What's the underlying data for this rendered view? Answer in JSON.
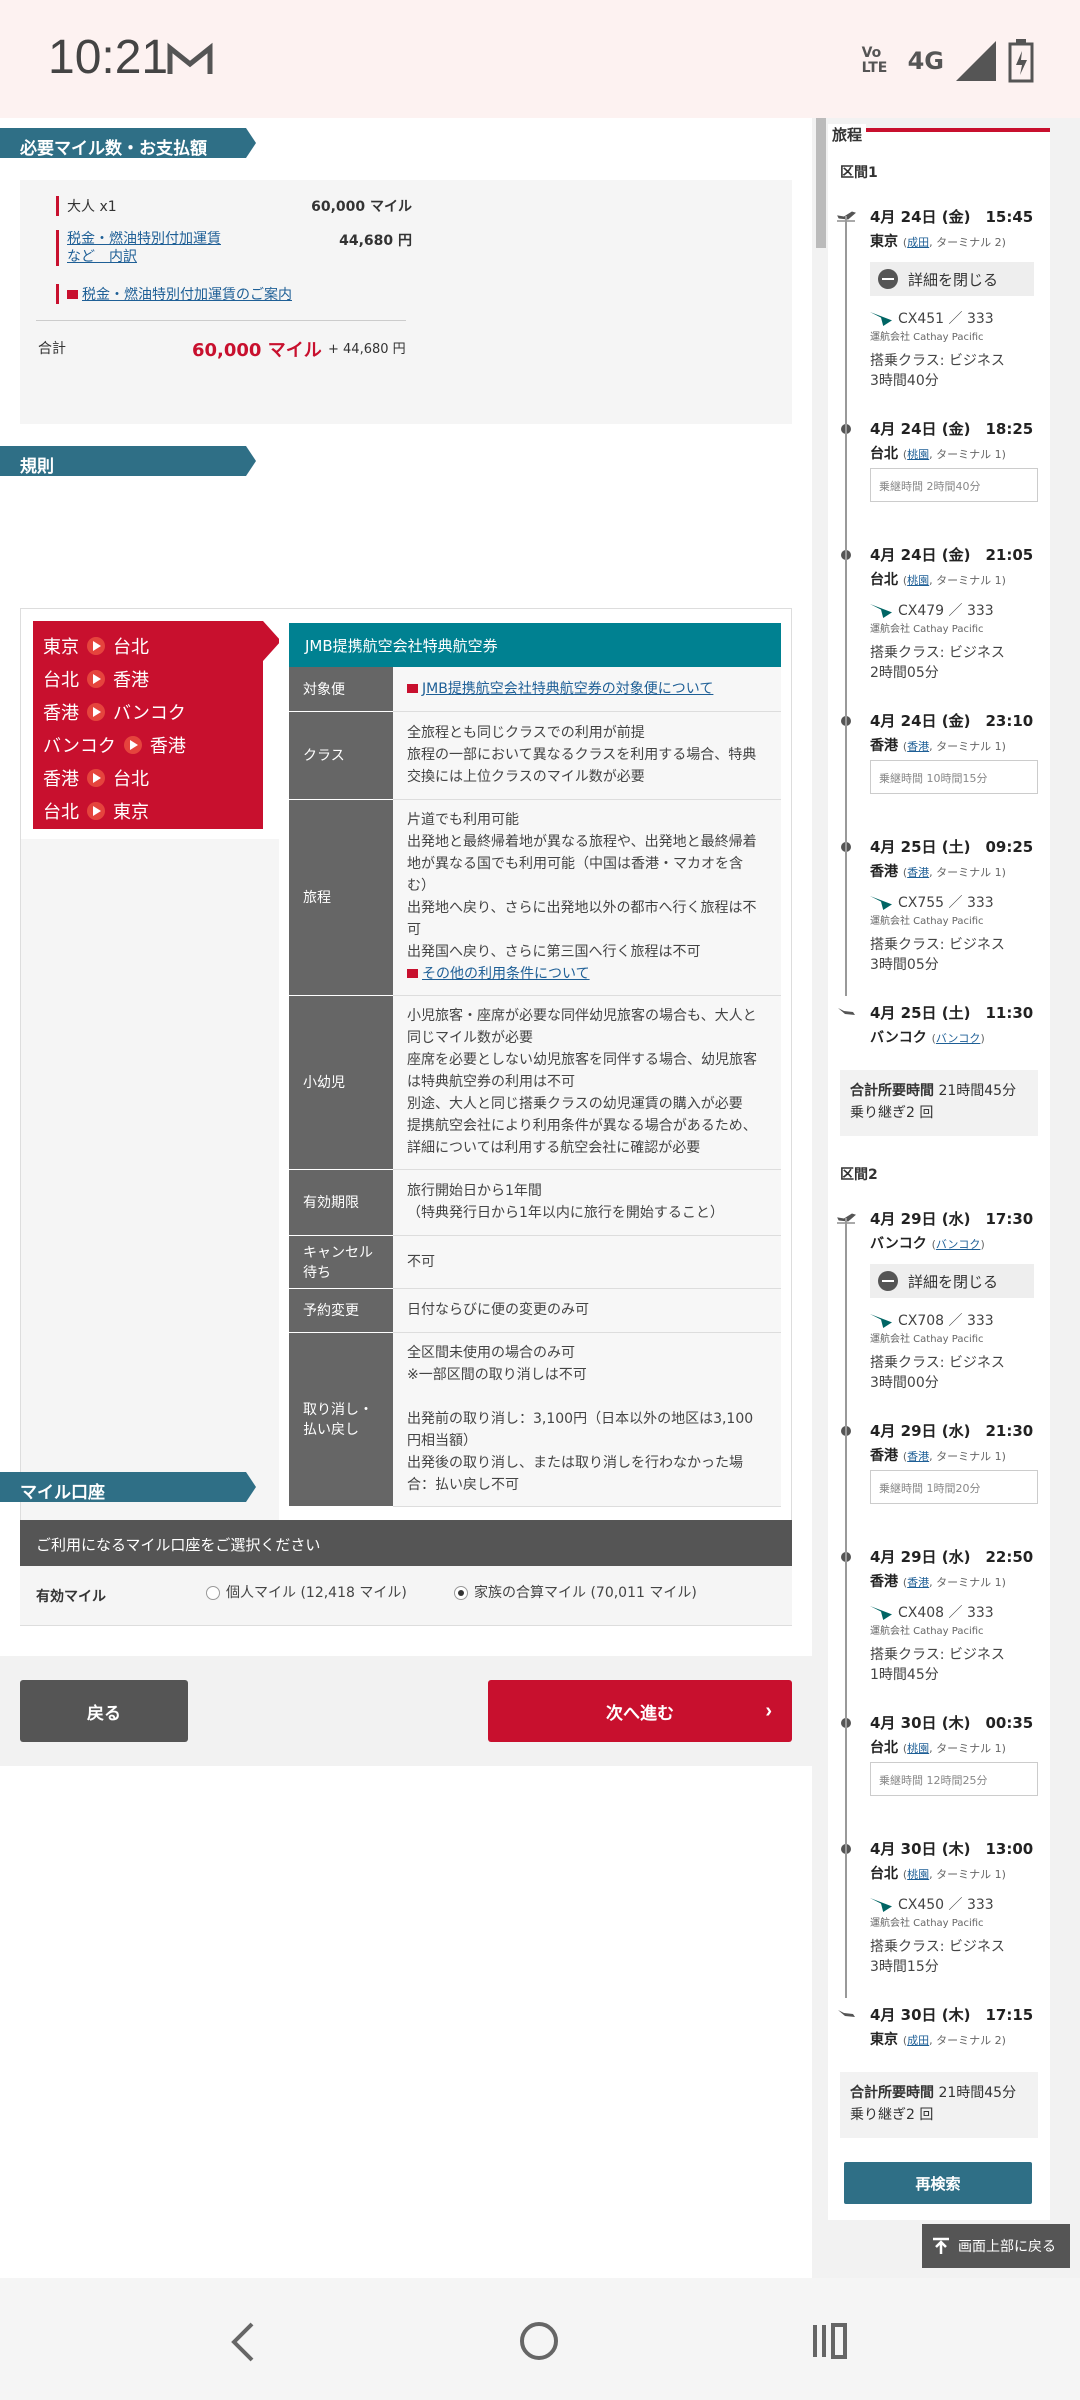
{
  "status": {
    "time": "10:21",
    "net": "4G",
    "volte": "Vo LTE"
  },
  "fare": {
    "heading": "必要マイル数・お支払額",
    "adult_label": "大人 x1",
    "adult_miles": "60,000 マイル",
    "tax_link1": "税金・燃油特別付加運賃",
    "tax_link2": "など　内訳",
    "tax_amount": "44,680 円",
    "info_link": "税金・燃油特別付加運賃のご案内",
    "total_label": "合計",
    "total_miles": "60,000 マイル",
    "total_yen": "+ 44,680 円"
  },
  "rules": {
    "heading": "規則",
    "route": [
      {
        "from": "東京",
        "to": "台北"
      },
      {
        "from": "台北",
        "to": "香港"
      },
      {
        "from": "香港",
        "to": "バンコク"
      },
      {
        "from": "バンコク",
        "to": "香港"
      },
      {
        "from": "香港",
        "to": "台北"
      },
      {
        "from": "台北",
        "to": "東京"
      }
    ],
    "panel_title": "JMB提携航空会社特典航空券",
    "rows": [
      {
        "k": "対象便",
        "v": "JMB提携航空会社特典航空券の対象便について"
      },
      {
        "k": "クラス",
        "v": "全旅程とも同じクラスでの利用が前提\n旅程の一部において異なるクラスを利用する場合、特典交換には上位クラスのマイル数が必要"
      },
      {
        "k": "旅程",
        "v": "片道でも利用可能\n出発地と最終帰着地が異なる旅程や、出発地と最終帰着地が異なる国でも利用可能（中国は香港・マカオを含む）\n出発地へ戻り、さらに出発地以外の都市へ行く旅程は不可\n出発国へ戻り、さらに第三国へ行く旅程は不可",
        "link": "その他の利用条件について"
      },
      {
        "k": "小幼児",
        "v": "小児旅客・座席が必要な同伴幼児旅客の場合も、大人と同じマイル数が必要\n座席を必要としない幼児旅客を同伴する場合、幼児旅客は特典航空券の利用は不可\n別途、大人と同じ搭乗クラスの幼児運賃の購入が必要\n提携航空会社により利用条件が異なる場合があるため、詳細については利用する航空会社に確認が必要"
      },
      {
        "k": "有効期限",
        "v": "旅行開始日から1年間\n（特典発行日から1年以内に旅行を開始すること）"
      },
      {
        "k": "キャンセル待ち",
        "v": "不可"
      },
      {
        "k": "予約変更",
        "v": "日付ならびに便の変更のみ可"
      },
      {
        "k": "取り消し・払い戻し",
        "v": "全区間未使用の場合のみ可\n※一部区間の取り消しは不可\n\n出発前の取り消し：3,100円（日本以外の地区は3,100円相当額）\n出発後の取り消し、または取り消しを行わなかった場合：払い戻し不可"
      }
    ]
  },
  "account": {
    "heading": "マイル口座",
    "prompt": "ご利用になるマイル口座をご選択ください",
    "label": "有効マイル",
    "opt1": "個人マイル (12,418 マイル)",
    "opt2": "家族の合算マイル (70,011 マイル)"
  },
  "buttons": {
    "back": "戻る",
    "next": "次へ進む",
    "research": "再検索",
    "totop": "画面上部に戻る"
  },
  "itinerary": {
    "title": "旅程",
    "seg1": "区間1",
    "seg2": "区間2",
    "detail_close": "詳細を閉じる",
    "operator": "運航会社 Cathay Pacific",
    "s1": [
      {
        "d": "4月 24日 (金)　15:45",
        "p": "東京",
        "a": "成田",
        "t": "ターミナル 2"
      },
      {
        "f": "CX451 ／ 333",
        "c": "搭乗クラス: ビジネス",
        "dur": "3時間40分"
      },
      {
        "d": "4月 24日 (金)　18:25",
        "p": "台北",
        "a": "桃園",
        "t": "ターミナル 1"
      },
      {
        "conn": "乗継時間 2時間40分"
      },
      {
        "d": "4月 24日 (金)　21:05",
        "p": "台北",
        "a": "桃園",
        "t": "ターミナル 1"
      },
      {
        "f": "CX479 ／ 333",
        "c": "搭乗クラス: ビジネス",
        "dur": "2時間05分"
      },
      {
        "d": "4月 24日 (金)　23:10",
        "p": "香港",
        "a": "香港",
        "t": "ターミナル 1"
      },
      {
        "conn": "乗継時間 10時間15分"
      },
      {
        "d": "4月 25日 (土)　09:25",
        "p": "香港",
        "a": "香港",
        "t": "ターミナル 1"
      },
      {
        "f": "CX755 ／ 333",
        "c": "搭乗クラス: ビジネス",
        "dur": "3時間05分"
      },
      {
        "d": "4月 25日 (土)　11:30",
        "p": "バンコク",
        "a": "バンコク",
        "t": ""
      }
    ],
    "s1_total": "21時間45分",
    "s1_transfer": "乗り継ぎ2 回",
    "total_label": "合計所要時間",
    "s2": [
      {
        "d": "4月 29日 (水)　17:30",
        "p": "バンコク",
        "a": "バンコク",
        "t": ""
      },
      {
        "f": "CX708 ／ 333",
        "c": "搭乗クラス: ビジネス",
        "dur": "3時間00分"
      },
      {
        "d": "4月 29日 (水)　21:30",
        "p": "香港",
        "a": "香港",
        "t": "ターミナル 1"
      },
      {
        "conn": "乗継時間 1時間20分"
      },
      {
        "d": "4月 29日 (水)　22:50",
        "p": "香港",
        "a": "香港",
        "t": "ターミナル 1"
      },
      {
        "f": "CX408 ／ 333",
        "c": "搭乗クラス: ビジネス",
        "dur": "1時間45分"
      },
      {
        "d": "4月 30日 (木)　00:35",
        "p": "台北",
        "a": "桃園",
        "t": "ターミナル 1"
      },
      {
        "conn": "乗継時間 12時間25分"
      },
      {
        "d": "4月 30日 (木)　13:00",
        "p": "台北",
        "a": "桃園",
        "t": "ターミナル 1"
      },
      {
        "f": "CX450 ／ 333",
        "c": "搭乗クラス: ビジネス",
        "dur": "3時間15分"
      },
      {
        "d": "4月 30日 (木)　17:15",
        "p": "東京",
        "a": "成田",
        "t": "ターミナル 2"
      }
    ],
    "s2_total": "21時間45分",
    "s2_transfer": "乗り継ぎ2 回"
  }
}
